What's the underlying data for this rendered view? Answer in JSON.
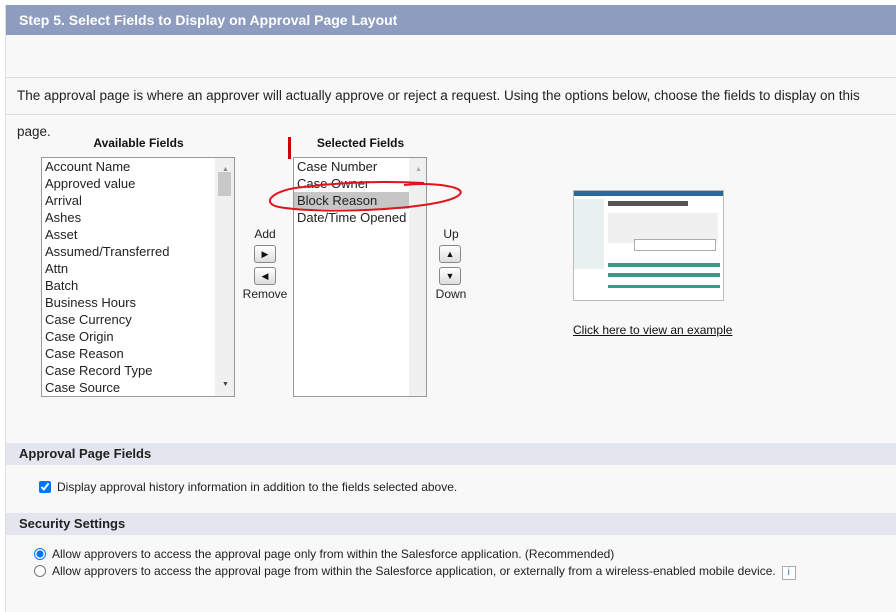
{
  "header": {
    "title": "Step 5. Select Fields to Display on Approval Page Layout"
  },
  "description": "The approval page is where an approver will actually approve or reject a request. Using the options below, choose the fields to display on this page.",
  "available": {
    "label": "Available Fields",
    "items": [
      "Account Name",
      "Approved value",
      "Arrival",
      "Ashes",
      "Asset",
      "Assumed/Transferred",
      "Attn",
      "Batch",
      "Business Hours",
      "Case Currency",
      "Case Origin",
      "Case Reason",
      "Case Record Type",
      "Case Source"
    ]
  },
  "buttons": {
    "add": "Add",
    "remove": "Remove",
    "up": "Up",
    "down": "Down"
  },
  "selected": {
    "label": "Selected Fields",
    "items": [
      "Case Number",
      "Case Owner",
      "Block Reason",
      "Date/Time Opened"
    ],
    "highlighted": "Block Reason"
  },
  "example_link": "Click here to view an example",
  "approval_fields": {
    "title": "Approval Page Fields",
    "checkbox_label": "Display approval history information in addition to the fields selected above.",
    "checked": true
  },
  "security": {
    "title": "Security Settings",
    "options": [
      "Allow approvers to access the approval page only from within the Salesforce application. (Recommended)",
      "Allow approvers to access the approval page from within the Salesforce application, or externally from a wireless-enabled mobile device."
    ],
    "selected_index": 0,
    "info_icon": "i"
  },
  "colors": {
    "header": "#8e9dbf",
    "annotation": "#e0141e"
  }
}
